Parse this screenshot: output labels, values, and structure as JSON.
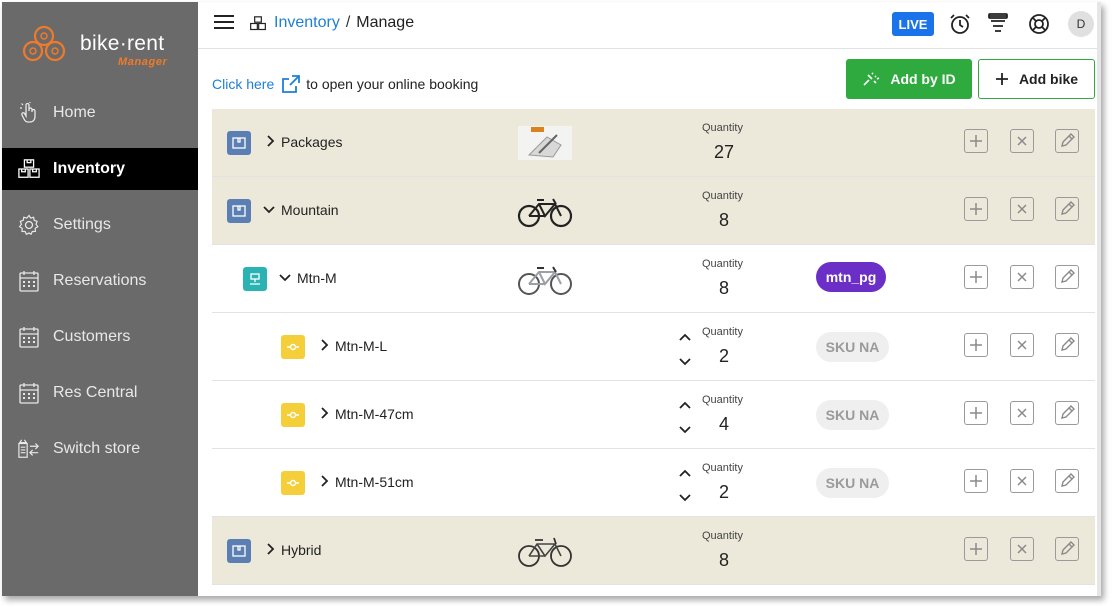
{
  "brand": {
    "name": "bike·rent",
    "sub": "Manager",
    "accent": "#f07a2a"
  },
  "sidebar": {
    "items": [
      {
        "label": "Home",
        "icon": "hand-pointer-icon",
        "active": false
      },
      {
        "label": "Inventory",
        "icon": "boxes-icon",
        "active": true
      },
      {
        "label": "Settings",
        "icon": "gear-icon",
        "active": false
      },
      {
        "label": "Reservations",
        "icon": "calendar-icon",
        "active": false
      },
      {
        "label": "Customers",
        "icon": "calendar-icon",
        "active": false
      },
      {
        "label": "Res Central",
        "icon": "calendar-icon",
        "active": false
      },
      {
        "label": "Switch store",
        "icon": "switch-store-icon",
        "active": false
      }
    ]
  },
  "header": {
    "breadcrumb_link": "Inventory",
    "breadcrumb_sep": "/",
    "breadcrumb_current": "Manage",
    "live_label": "LIVE",
    "avatar_initial": "D"
  },
  "toolbar": {
    "booking_link": "Click here",
    "booking_text": "to open your online booking",
    "add_by_id": "Add by ID",
    "add_bike": "Add bike"
  },
  "inventory": {
    "quantity_label": "Quantity",
    "rows": [
      {
        "name": "Packages",
        "quantity": "27",
        "level": 0,
        "kind": "group",
        "expanded": false
      },
      {
        "name": "Mountain",
        "quantity": "8",
        "level": 0,
        "kind": "group",
        "expanded": true
      },
      {
        "name": "Mtn-M",
        "quantity": "8",
        "level": 1,
        "kind": "model",
        "expanded": true,
        "pill": "mtn_pg"
      },
      {
        "name": "Mtn-M-L",
        "quantity": "2",
        "level": 2,
        "kind": "sku",
        "expanded": false,
        "pill": "SKU NA"
      },
      {
        "name": "Mtn-M-47cm",
        "quantity": "4",
        "level": 2,
        "kind": "sku",
        "expanded": false,
        "pill": "SKU NA"
      },
      {
        "name": "Mtn-M-51cm",
        "quantity": "2",
        "level": 2,
        "kind": "sku",
        "expanded": false,
        "pill": "SKU NA"
      },
      {
        "name": "Hybrid",
        "quantity": "8",
        "level": 0,
        "kind": "group",
        "expanded": false
      }
    ]
  },
  "colors": {
    "sidebar_bg": "#6a6a6a",
    "active_nav": "#000000",
    "group_row": "#ece9da",
    "primary_green": "#2eaa3f",
    "live_blue": "#1a73e8",
    "link_blue": "#1e7fd6",
    "pill_purple": "#6b2fc7"
  }
}
